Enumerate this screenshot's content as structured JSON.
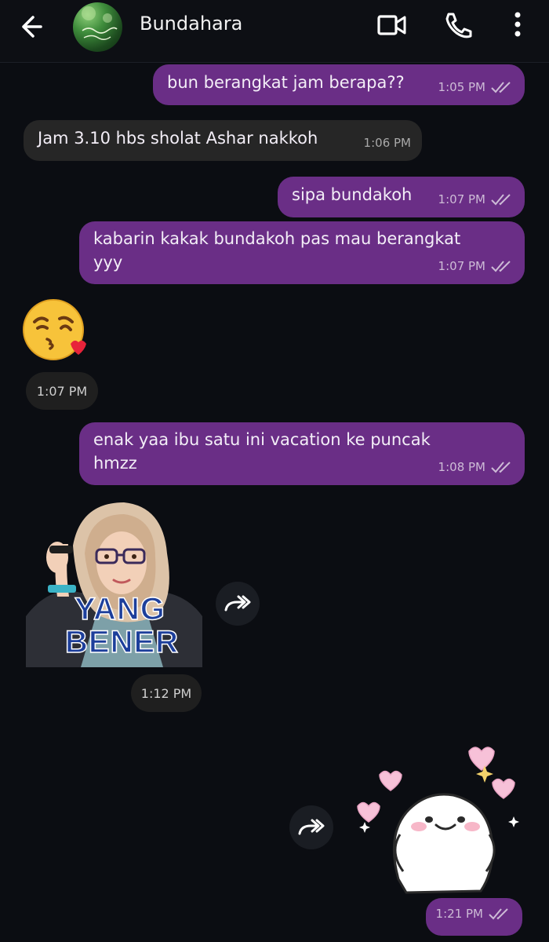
{
  "header": {
    "contact_name": "Bundahara",
    "icons": [
      "back-arrow-icon",
      "video-call-icon",
      "phone-call-icon",
      "more-options-icon"
    ]
  },
  "messages": [
    {
      "direction": "outgoing",
      "text": "bun berangkat jam berapa??",
      "time": "1:05 PM",
      "read": true
    },
    {
      "direction": "incoming",
      "text": "Jam 3.10 hbs sholat Ashar nakkoh",
      "time": "1:06 PM"
    },
    {
      "direction": "outgoing",
      "text": "sipa bundakoh",
      "time": "1:07 PM",
      "read": true
    },
    {
      "direction": "outgoing",
      "text_line1": "kabarin kakak bundakoh pas mau berangkat",
      "text_line2": "yyy",
      "time": "1:07 PM",
      "read": true
    },
    {
      "direction": "incoming",
      "type": "emoji",
      "emoji": "😘",
      "time": "1:07 PM"
    },
    {
      "direction": "outgoing",
      "text_line1": "enak yaa ibu satu ini vacation ke puncak",
      "text_line2": "hmzz",
      "time": "1:08 PM",
      "read": true
    },
    {
      "direction": "incoming",
      "type": "sticker",
      "caption_line1": "YANG",
      "caption_line2": "BENER",
      "time": "1:12 PM"
    },
    {
      "direction": "outgoing",
      "type": "sticker",
      "time": "1:21 PM",
      "read": true
    }
  ],
  "colors": {
    "background": "#0b0d12",
    "outgoing_bubble": "#6a2e86",
    "incoming_bubble": "#262626",
    "time_chip": "#1f1f1f"
  }
}
